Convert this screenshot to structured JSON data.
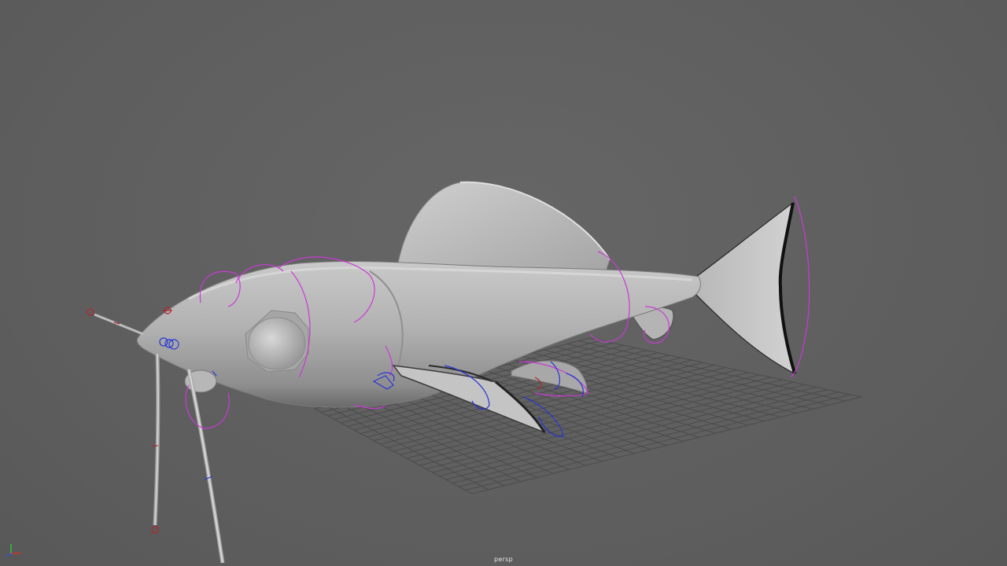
{
  "viewport": {
    "camera_name": "persp"
  },
  "scene": {
    "model": "fish-rig",
    "grid": true,
    "colors": {
      "background": "#5f5f5f",
      "grid_line": "#4a4a4a",
      "mesh_light": "#c8c8c8",
      "mesh_mid": "#a3a3a3",
      "mesh_dark": "#6e6e6e",
      "control_magenta": "#c93ad6",
      "control_blue": "#2636d6",
      "control_red": "#b3262e"
    }
  },
  "axis_gizmo": {
    "axes": [
      "x",
      "y",
      "z"
    ],
    "colors": {
      "x": "#d23030",
      "y": "#30c040",
      "z": "#3050e0"
    }
  }
}
